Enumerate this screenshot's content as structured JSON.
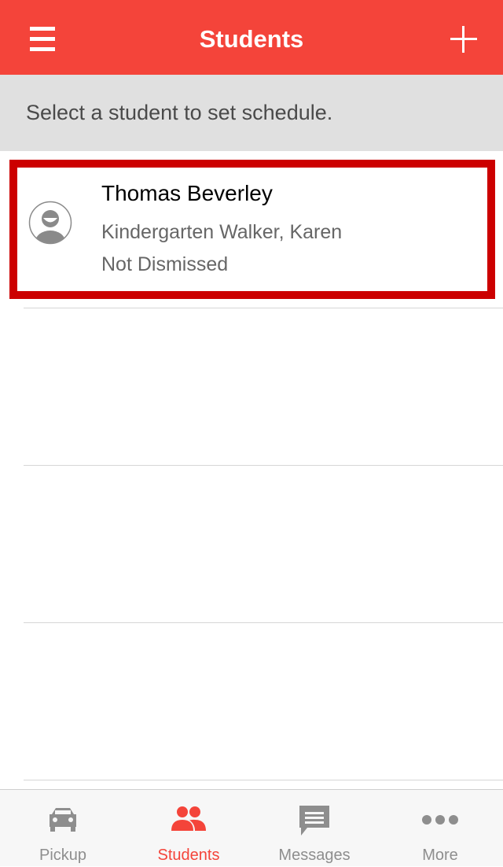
{
  "header": {
    "title": "Students",
    "menu_icon": "hamburger-menu-icon",
    "add_icon": "plus-icon",
    "color": "#f4443a"
  },
  "instruction": {
    "text": "Select a student to set schedule."
  },
  "students": [
    {
      "name": "Thomas Beverley",
      "class": "Kindergarten Walker, Karen",
      "status": "Not Dismissed",
      "avatar_icon": "user-avatar-icon"
    }
  ],
  "highlight_color": "#cc0000",
  "tabs": [
    {
      "label": "Pickup",
      "icon": "car-icon",
      "active": false
    },
    {
      "label": "Students",
      "icon": "people-icon",
      "active": true
    },
    {
      "label": "Messages",
      "icon": "message-icon",
      "active": false
    },
    {
      "label": "More",
      "icon": "more-dots-icon",
      "active": false
    }
  ],
  "colors": {
    "accent": "#f4443a",
    "tab_inactive": "#8e8e8e"
  }
}
